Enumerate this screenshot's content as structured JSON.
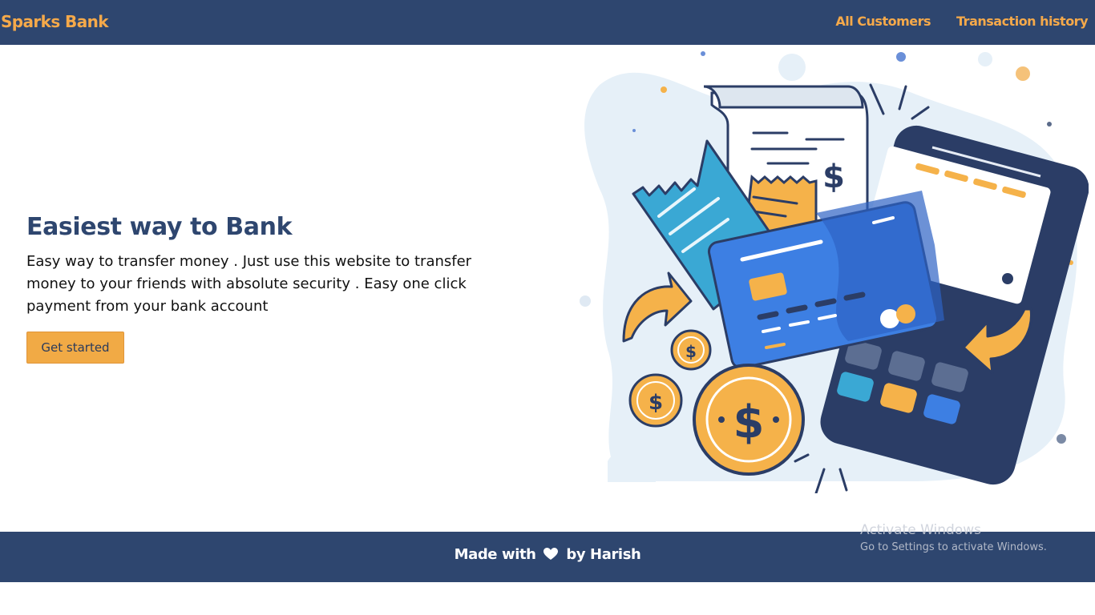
{
  "navbar": {
    "brand": "Sparks Bank",
    "links": [
      "All Customers",
      "Transaction history"
    ]
  },
  "hero": {
    "title": "Easiest way to Bank",
    "description": "Easy way to transfer money . Just use this website to transfer money to your friends with absolute security . Easy one click payment from your bank account",
    "button_label": "Get started"
  },
  "illustration": {
    "coin_symbol": "$",
    "receipt_symbol": "$"
  },
  "footer": {
    "prefix": "Made with",
    "icon": "heart-icon",
    "suffix": "by Harish"
  },
  "watermark": {
    "title": "Activate Windows",
    "subtitle": "Go to Settings to activate Windows."
  },
  "colors": {
    "navy": "#2e466f",
    "accent": "#f5a94a",
    "button": "#f1aa45",
    "card_blue": "#3d7fe3",
    "teal": "#3aa8d4"
  }
}
